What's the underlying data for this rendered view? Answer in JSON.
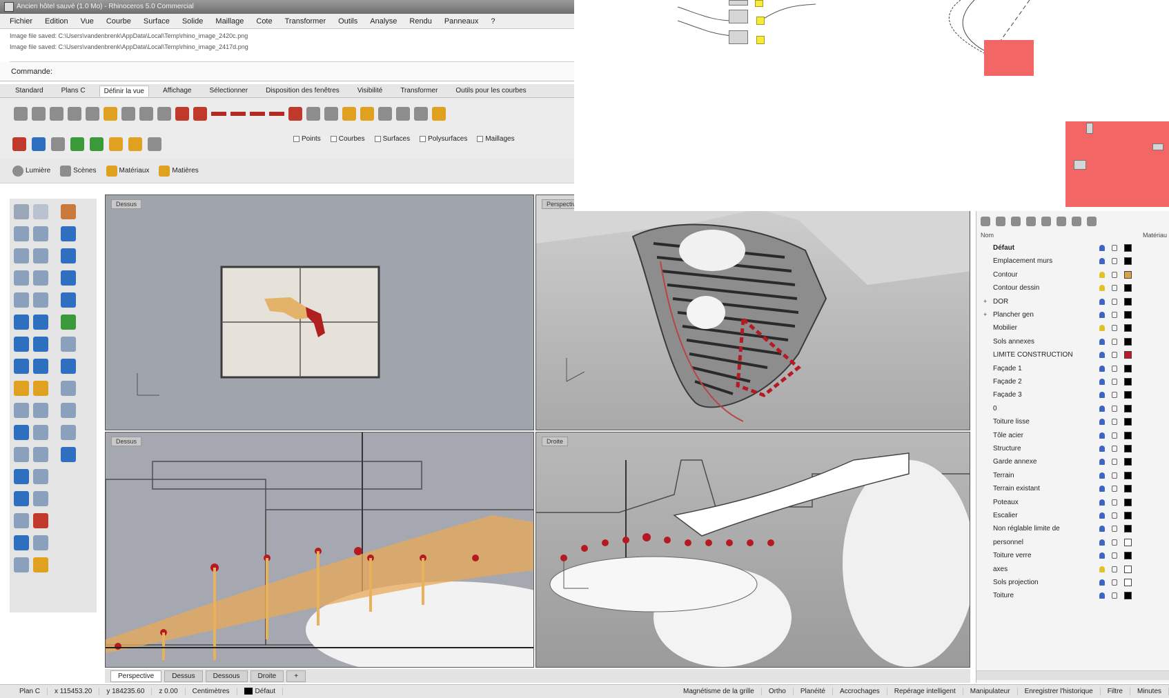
{
  "window": {
    "title": "Ancien hôtel sauvé (1.0 Mo) - Rhinoceros 5.0 Commercial"
  },
  "menu": [
    "Fichier",
    "Edition",
    "Vue",
    "Courbe",
    "Surface",
    "Solide",
    "Maillage",
    "Cote",
    "Transformer",
    "Outils",
    "Analyse",
    "Rendu",
    "Panneaux",
    "?"
  ],
  "history": [
    "Image file saved: C:\\Users\\vandenbrenk\\AppData\\Local\\Temp\\rhino_image_2420c.png",
    "Image file saved: C:\\Users\\vandenbrenk\\AppData\\Local\\Temp\\rhino_image_2417d.png"
  ],
  "command": {
    "label": "Commande:"
  },
  "toolbar_tabs": [
    "Standard",
    "Plans C",
    "Définir la vue",
    "Affichage",
    "Sélectionner",
    "Disposition des fenêtres",
    "Visibilité",
    "Transformer",
    "Outils pour les courbes"
  ],
  "toolbar_tab_active": 2,
  "filters": [
    "Points",
    "Courbes",
    "Surfaces",
    "Polysurfaces",
    "Maillages"
  ],
  "render_toolbar": {
    "items": [
      "Lumière",
      "Scènes",
      "Matériaux",
      "Matières"
    ]
  },
  "viewports": {
    "top": {
      "label": "Dessus"
    },
    "perspective": {
      "label": "Perspective"
    },
    "front": {
      "label": "Dessus"
    },
    "right": {
      "label": "Droite"
    }
  },
  "viewport_tabs": [
    "Perspective",
    "Dessus",
    "Dessous",
    "Droite",
    "+"
  ],
  "viewport_tab_active": 0,
  "status": {
    "plane": "Plan C",
    "x": "x 115453.20",
    "y": "y 184235.60",
    "z": "z 0.00",
    "units": "Centimètres",
    "layer": "Défaut",
    "items": [
      "Magnétisme de la grille",
      "Ortho",
      "Planéité",
      "Accrochages",
      "Repérage intelligent",
      "Manipulateur",
      "Enregistrer l'historique",
      "Filtre",
      "Minutes"
    ]
  },
  "layers": {
    "header_name": "Nom",
    "header_material": "Matériau",
    "rows": [
      {
        "name": "Défaut",
        "bold": true,
        "on": true,
        "color": "#000000"
      },
      {
        "name": "Emplacement murs",
        "on": true,
        "color": "#000000"
      },
      {
        "name": "Contour",
        "on": false,
        "color": "#d9a14a"
      },
      {
        "name": "Contour dessin",
        "on": false,
        "color": "#000000"
      },
      {
        "name": "DOR",
        "toggle": "+",
        "on": true,
        "color": "#000000"
      },
      {
        "name": "Plancher gen",
        "toggle": "+",
        "on": true,
        "color": "#000000"
      },
      {
        "name": "Mobilier",
        "on": false,
        "color": "#000000"
      },
      {
        "name": "Sols annexes",
        "on": true,
        "color": "#000000"
      },
      {
        "name": "LIMITE CONSTRUCTION",
        "on": true,
        "color": "#c0182a"
      },
      {
        "name": "Façade 1",
        "on": true,
        "color": "#000000"
      },
      {
        "name": "Façade 2",
        "on": true,
        "color": "#000000"
      },
      {
        "name": "Façade 3",
        "on": true,
        "color": "#000000"
      },
      {
        "name": "0",
        "on": true,
        "color": "#000000"
      },
      {
        "name": "Toiture lisse",
        "on": true,
        "color": "#000000"
      },
      {
        "name": "Tôle acier",
        "on": true,
        "color": "#000000"
      },
      {
        "name": "Structure",
        "on": true,
        "color": "#000000"
      },
      {
        "name": "Garde annexe",
        "on": true,
        "color": "#000000"
      },
      {
        "name": "Terrain",
        "on": true,
        "color": "#000000"
      },
      {
        "name": "Terrain existant",
        "on": true,
        "color": "#000000"
      },
      {
        "name": "Poteaux",
        "on": true,
        "color": "#000000"
      },
      {
        "name": "Escalier",
        "on": true,
        "color": "#000000"
      },
      {
        "name": "Non réglable limite de",
        "on": true,
        "color": "#000000"
      },
      {
        "name": "personnel",
        "on": true,
        "color": "#ffffff"
      },
      {
        "name": "Toiture verre",
        "on": true,
        "color": "#000000"
      },
      {
        "name": "axes",
        "on": false,
        "color": "#ffffff"
      },
      {
        "name": "Sols projection",
        "on": true,
        "color": "#ffffff"
      },
      {
        "name": "Toiture",
        "on": true,
        "color": "#000000"
      }
    ]
  },
  "colors": {
    "viewport_bg": "#a0a4ad",
    "selection": "#c8202a",
    "gh_group": "#f26666",
    "gh_param": "#f6ea3a"
  }
}
